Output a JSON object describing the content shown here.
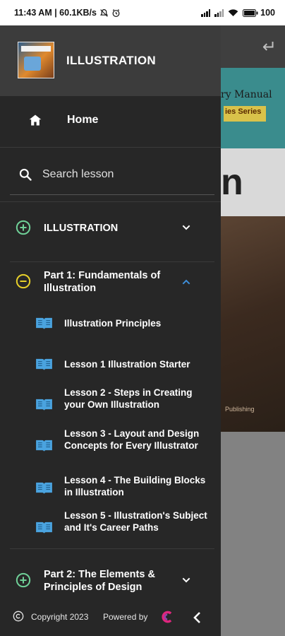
{
  "status_bar": {
    "time_speed": "11:43 AM | 60.1KB/s",
    "battery": "100"
  },
  "background_page": {
    "banner_text": "ry Manual",
    "banner_series": "ies Series",
    "title_fragment": "n",
    "publisher_fragment": "Publishing"
  },
  "drawer": {
    "app_title": "ILLUSTRATION",
    "home_label": "Home",
    "search_placeholder": "Search lesson",
    "groups": [
      {
        "label": "ILLUSTRATION",
        "state": "collapsed"
      },
      {
        "label": "Part 1: Fundamentals of Illustration",
        "state": "expanded"
      },
      {
        "label": "Part 2: The Elements & Principles of Design",
        "state": "collapsed"
      }
    ],
    "lessons": [
      "Illustration Principles",
      "Lesson 1 Illustration Starter",
      "Lesson 2 - Steps in Creating your Own Illustration",
      "Lesson 3 - Layout and Design Concepts for Every Illustrator",
      "Lesson 4 - The Building Blocks in Illustration",
      "Lesson 5 - Illustration's Subject and It's Career Paths"
    ],
    "footer": {
      "copyright": "Copyright 2023",
      "powered_by": "Powered by"
    }
  },
  "colors": {
    "drawer_bg": "#272727",
    "header_bg": "#3c3c3c",
    "green_icon": "#6fcf97",
    "yellow_icon": "#e6cf2a",
    "blue_accent": "#3e8ed9",
    "book_icon": "#4aa3df"
  },
  "icons": [
    "home-icon",
    "search-icon",
    "plus-circle-icon",
    "minus-circle-icon",
    "chevron-down-icon",
    "chevron-up-icon",
    "book-open-icon",
    "copyright-icon",
    "chevron-left-icon",
    "back-arrow-icon"
  ]
}
